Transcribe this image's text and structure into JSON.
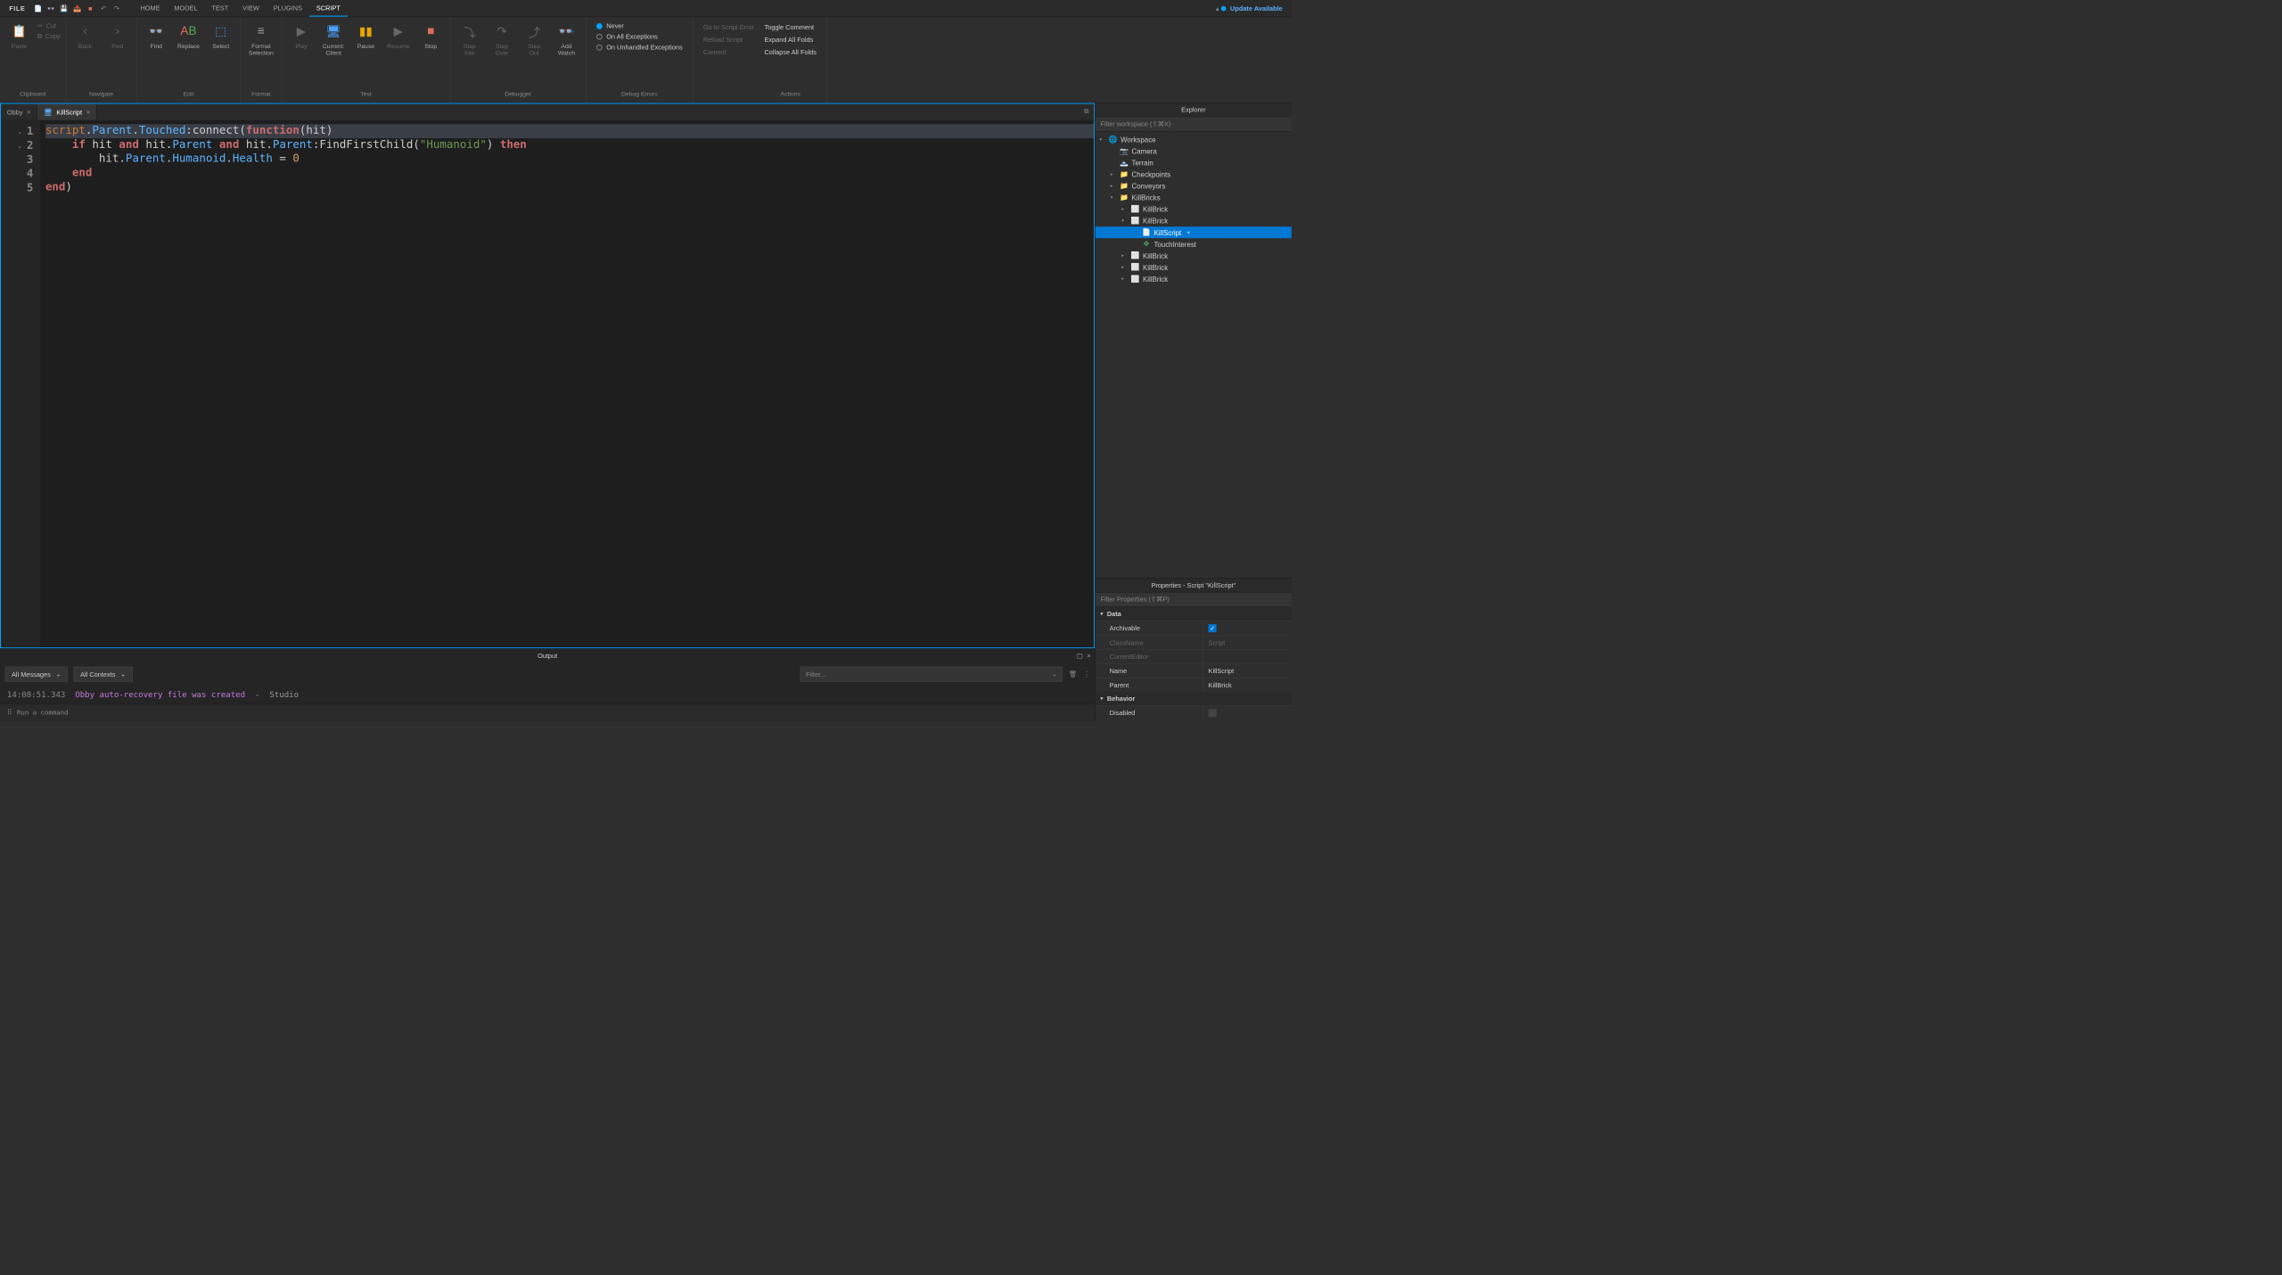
{
  "menubar": {
    "file": "FILE",
    "tabs": [
      "HOME",
      "MODEL",
      "TEST",
      "VIEW",
      "PLUGINS",
      "SCRIPT"
    ],
    "active_tab": 5,
    "update_label": "Update Available"
  },
  "ribbon": {
    "groups": [
      {
        "name": "Clipboard",
        "buttons": [
          {
            "label": "Paste",
            "icon": "paste-icon",
            "dim": true
          },
          {
            "label": "Cut",
            "icon": "cut-icon",
            "dim": true,
            "small": true
          },
          {
            "label": "Copy",
            "icon": "copy-icon",
            "dim": true,
            "small": true
          }
        ]
      },
      {
        "name": "Navigate",
        "buttons": [
          {
            "label": "Back",
            "icon": "back-icon",
            "dim": true
          },
          {
            "label": "Fwd",
            "icon": "fwd-icon",
            "dim": true
          }
        ]
      },
      {
        "name": "Edit",
        "buttons": [
          {
            "label": "Find",
            "icon": "find-icon"
          },
          {
            "label": "Replace",
            "icon": "replace-icon"
          },
          {
            "label": "Select",
            "icon": "select-icon"
          }
        ]
      },
      {
        "name": "Format",
        "buttons": [
          {
            "label": "Format\nSelection",
            "icon": "format-icon"
          }
        ]
      },
      {
        "name": "Test",
        "buttons": [
          {
            "label": "Play",
            "icon": "play-icon",
            "dim": true
          },
          {
            "label": "Current:\nClient",
            "icon": "client-icon"
          },
          {
            "label": "Pause",
            "icon": "pause-icon"
          },
          {
            "label": "Resume",
            "icon": "resume-icon",
            "dim": true
          },
          {
            "label": "Stop",
            "icon": "stop-icon"
          }
        ]
      },
      {
        "name": "Debugger",
        "buttons": [
          {
            "label": "Step\nInto",
            "icon": "stepinto-icon",
            "dim": true
          },
          {
            "label": "Step\nOver",
            "icon": "stepover-icon",
            "dim": true
          },
          {
            "label": "Step\nOut",
            "icon": "stepout-icon",
            "dim": true
          },
          {
            "label": "Add\nWatch",
            "icon": "watch-icon"
          }
        ]
      },
      {
        "name": "Debug Errors",
        "list": [
          {
            "label": "Never",
            "selected": true
          },
          {
            "label": "On All Exceptions",
            "selected": false
          },
          {
            "label": "On Unhandled Exceptions",
            "selected": false
          }
        ]
      },
      {
        "name": "Actions",
        "links": [
          {
            "label": "Go to Script Error",
            "dim": true
          },
          {
            "label": "Reload Script",
            "dim": true
          },
          {
            "label": "Commit",
            "dim": true
          }
        ],
        "links2": [
          {
            "label": "Toggle Comment"
          },
          {
            "label": "Expand All Folds"
          },
          {
            "label": "Collapse All Folds"
          }
        ]
      }
    ]
  },
  "file_tabs": [
    {
      "label": "Obby",
      "active": false,
      "has_icon": false
    },
    {
      "label": "KillScript",
      "active": true,
      "has_icon": true
    }
  ],
  "code_lines": [
    "1",
    "2",
    "3",
    "4",
    "5"
  ],
  "explorer": {
    "title": "Explorer",
    "search_placeholder": "Filter workspace (⇧⌘X)",
    "tree": [
      {
        "depth": 0,
        "tw": "▾",
        "icon": "🌐",
        "label": "Workspace",
        "color": "#5a9"
      },
      {
        "depth": 1,
        "tw": "",
        "icon": "📷",
        "label": "Camera"
      },
      {
        "depth": 1,
        "tw": "",
        "icon": "🗻",
        "label": "Terrain"
      },
      {
        "depth": 1,
        "tw": "▸",
        "icon": "📁",
        "label": "Checkpoints",
        "ic": "#e0b040"
      },
      {
        "depth": 1,
        "tw": "▸",
        "icon": "📁",
        "label": "Conveyors",
        "ic": "#e0b040"
      },
      {
        "depth": 1,
        "tw": "▾",
        "icon": "📁",
        "label": "KillBricks",
        "ic": "#e0b040"
      },
      {
        "depth": 2,
        "tw": "▸",
        "icon": "⬜",
        "label": "KillBrick"
      },
      {
        "depth": 2,
        "tw": "▾",
        "icon": "⬜",
        "label": "KillBrick"
      },
      {
        "depth": 3,
        "tw": "",
        "icon": "📄",
        "label": "KillScript",
        "selected": true,
        "badge": "+"
      },
      {
        "depth": 3,
        "tw": "",
        "icon": "✥",
        "label": "TouchInterest",
        "ic": "#5a5"
      },
      {
        "depth": 2,
        "tw": "▸",
        "icon": "⬜",
        "label": "KillBrick"
      },
      {
        "depth": 2,
        "tw": "▸",
        "icon": "⬜",
        "label": "KillBrick"
      },
      {
        "depth": 2,
        "tw": "▸",
        "icon": "⬜",
        "label": "KillBrick"
      }
    ]
  },
  "properties": {
    "title": "Properties - Script \"KillScript\"",
    "search_placeholder": "Filter Properties (⇧⌘P)",
    "sections": [
      {
        "name": "Data",
        "rows": [
          {
            "k": "Archivable",
            "v": "",
            "check": true
          },
          {
            "k": "ClassName",
            "v": "Script",
            "dim": true
          },
          {
            "k": "CurrentEditor",
            "v": "",
            "dim": true
          },
          {
            "k": "Name",
            "v": "KillScript"
          },
          {
            "k": "Parent",
            "v": "KillBrick"
          }
        ]
      },
      {
        "name": "Behavior",
        "rows": [
          {
            "k": "Disabled",
            "v": "",
            "check": false
          }
        ]
      }
    ]
  },
  "output": {
    "title": "Output",
    "dd1": "All Messages",
    "dd2": "All Contexts",
    "filter_placeholder": "Filter...",
    "line": {
      "ts": "14:08:51.343",
      "msg": "Obby auto-recovery file was created",
      "sep": "-",
      "src": "Studio"
    }
  },
  "cmdbar": {
    "placeholder": "Run a command"
  }
}
